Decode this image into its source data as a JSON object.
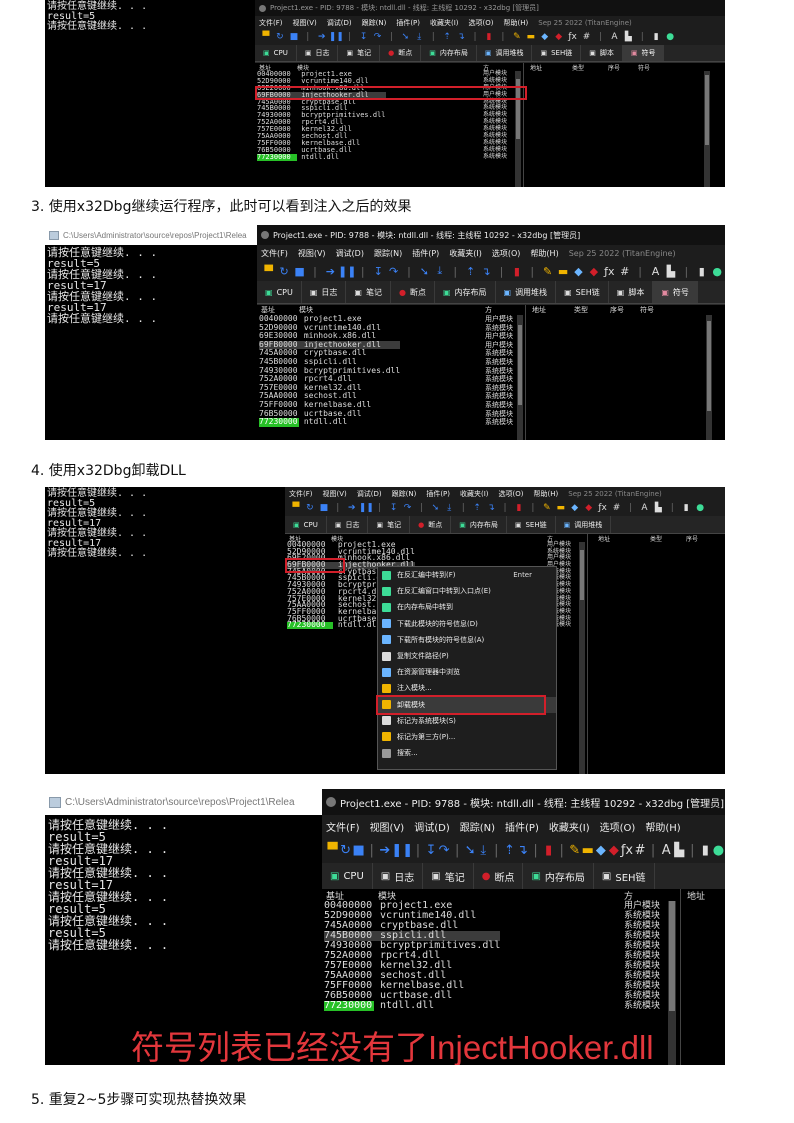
{
  "colors": {
    "accent_red": "#d21f2a",
    "green_base": "#27c027",
    "overlay_red": "#e3373c"
  },
  "captions": {
    "step3": "3. 使用x32Dbg继续运行程序，此时可以看到注入之后的效果",
    "step4": "4. 使用x32Dbg卸载DLL",
    "step5": "5. 重复2~5步骤可实现热替换效果"
  },
  "shot1": {
    "cmd_lines": [
      "请按任意键继续. . .",
      "result=5",
      "请按任意键继续. . ."
    ],
    "dbg_title": "Project1.exe - PID: 9788 - 模块: ntdll.dll - 线程: 主线程 10292 - x32dbg [管理员]",
    "menu": [
      "文件(F)",
      "视图(V)",
      "调试(D)",
      "跟踪(N)",
      "插件(P)",
      "收藏夹(I)",
      "选项(O)",
      "帮助(H)"
    ],
    "date": "Sep 25 2022 (TitanEngine)",
    "tabs": [
      "CPU",
      "日志",
      "笔记",
      "断点",
      "内存布局",
      "调用堆栈",
      "SEH链",
      "脚本",
      "符号"
    ],
    "hdr_base": "基址",
    "hdr_module": "模块",
    "hdr_party": "方",
    "hdr_addr": "地址",
    "hdr_type": "类型",
    "hdr_ord": "序号",
    "hdr_sym": "符号",
    "bases": [
      "00400000",
      "52D90000",
      "69E20000",
      "69FB0000",
      "745A0000",
      "745B0000",
      "74930000",
      "752A0000",
      "757E0000",
      "75AA0000",
      "75FF0000",
      "76B50000",
      "77230000"
    ],
    "modules": [
      "project1.exe",
      "vcruntime140.dll",
      "minhook.x86.dll",
      "injecthooker.dll",
      "cryptbase.dll",
      "sspicli.dll",
      "bcryptprimitives.dll",
      "rpcrt4.dll",
      "kernel32.dll",
      "sechost.dll",
      "kernelbase.dll",
      "ucrtbase.dll",
      "ntdll.dll"
    ],
    "parties": [
      "用户模块",
      "系统模块",
      "用户模块",
      "用户模块",
      "系统模块",
      "系统模块",
      "系统模块",
      "系统模块",
      "系统模块",
      "系统模块",
      "系统模块",
      "系统模块",
      "系统模块"
    ]
  },
  "shot2": {
    "cmd_title": "C:\\Users\\Administrator\\source\\repos\\Project1\\Relea",
    "cmd_lines": [
      "请按任意键继续. . .",
      "result=5",
      "请按任意键继续. . .",
      "result=17",
      "请按任意键继续. . .",
      "result=17",
      "请按任意键继续. . ."
    ],
    "dbg_title": "Project1.exe - PID: 9788 - 模块: ntdll.dll - 线程: 主线程 10292 - x32dbg [管理员]",
    "date": "Sep 25 2022 (TitanEngine)",
    "bases": [
      "00400000",
      "52D90000",
      "69E30000",
      "69FB0000",
      "745A0000",
      "745B0000",
      "74930000",
      "752A0000",
      "757E0000",
      "75AA0000",
      "75FF0000",
      "76B50000",
      "77230000"
    ],
    "modules": [
      "project1.exe",
      "vcruntime140.dll",
      "minhook.x86.dll",
      "injecthooker.dll",
      "cryptbase.dll",
      "sspicli.dll",
      "bcryptprimitives.dll",
      "rpcrt4.dll",
      "kernel32.dll",
      "sechost.dll",
      "kernelbase.dll",
      "ucrtbase.dll",
      "ntdll.dll"
    ],
    "parties": [
      "用户模块",
      "系统模块",
      "用户模块",
      "用户模块",
      "系统模块",
      "系统模块",
      "系统模块",
      "系统模块",
      "系统模块",
      "系统模块",
      "系统模块",
      "系统模块",
      "系统模块"
    ]
  },
  "shot3": {
    "cmd_lines": [
      "请按任意键继续. . .",
      "result=5",
      "请按任意键继续. . .",
      "result=17",
      "请按任意键继续. . .",
      "result=17",
      "请按任意键继续. . ."
    ],
    "date": "Sep 25 2022 (TitanEngine)",
    "tabs": [
      "CPU",
      "日志",
      "笔记",
      "断点",
      "内存布局",
      "SEH链",
      "调用堆栈"
    ],
    "bases": [
      "00400000",
      "52D90000",
      "69E20000",
      "69FB0000",
      "745A0000",
      "745B0000",
      "74930000",
      "752A0000",
      "757E0000",
      "75AA0000",
      "75FF0000",
      "76B50000",
      "77230000"
    ],
    "modules": [
      "project1.exe",
      "vcruntime140.dll",
      "minhook.x86.dll",
      "injecthooker.dll",
      "cryptbas",
      "sspicli.d",
      "bcryptpr",
      "rpcrt4.d",
      "kernel32",
      "sechost.",
      "kernelba",
      "ucrtbase",
      "ntdll.dl"
    ],
    "parties": [
      "用户模块",
      "系统模块",
      "用户模块",
      "用户模块",
      "系统模块",
      "系统模块",
      "系统模块",
      "系统模块",
      "系统模块",
      "系统模块",
      "系统模块",
      "系统模块",
      "系统模块"
    ],
    "menu_items": [
      "在反汇编中转到(F)",
      "在反汇编窗口中转到入口点(E)",
      "在内存布局中转到",
      "下载此模块的符号信息(D)",
      "下载所有模块的符号信息(A)",
      "复制文件路径(P)",
      "在资源管理器中浏览",
      "注入模块...",
      "卸载模块",
      "标记为系统模块(S)",
      "标记为第三方(P)...",
      "搜索..."
    ],
    "menu_shortcut": "Enter"
  },
  "shot4": {
    "cmd_title": "C:\\Users\\Administrator\\source\\repos\\Project1\\Relea",
    "cmd_lines": [
      "请按任意键继续. . .",
      "result=5",
      "请按任意键继续. . .",
      "result=17",
      "请按任意键继续. . .",
      "result=17",
      "请按任意键继续. . .",
      "result=5",
      "请按任意键继续. . .",
      "result=5",
      "请按任意键继续. . ."
    ],
    "dbg_title": "Project1.exe - PID: 9788 - 模块: ntdll.dll - 线程: 主线程 10292 - x32dbg [管理员]",
    "menu": [
      "文件(F)",
      "视图(V)",
      "调试(D)",
      "跟踪(N)",
      "插件(P)",
      "收藏夹(I)",
      "选项(O)",
      "帮助(H)"
    ],
    "tabs": [
      "CPU",
      "日志",
      "笔记",
      "断点",
      "内存布局",
      "SEH链"
    ],
    "hdr_base": "基址",
    "hdr_module": "模块",
    "hdr_party": "方",
    "hdr_addr": "地址",
    "bases": [
      "00400000",
      "52D90000",
      "745A0000",
      "745B0000",
      "74930000",
      "752A0000",
      "757E0000",
      "75AA0000",
      "75FF0000",
      "76B50000",
      "77230000"
    ],
    "modules": [
      "project1.exe",
      "vcruntime140.dll",
      "cryptbase.dll",
      "sspicli.dll",
      "bcryptprimitives.dll",
      "rpcrt4.dll",
      "kernel32.dll",
      "sechost.dll",
      "kernelbase.dll",
      "ucrtbase.dll",
      "ntdll.dll"
    ],
    "parties": [
      "用户模块",
      "系统模块",
      "系统模块",
      "系统模块",
      "系统模块",
      "系统模块",
      "系统模块",
      "系统模块",
      "系统模块",
      "系统模块",
      "系统模块"
    ],
    "overlay": "符号列表已经没有了InjectHooker.dll"
  }
}
